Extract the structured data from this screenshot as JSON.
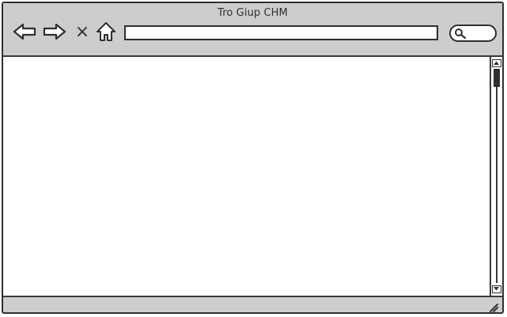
{
  "window": {
    "title": "Tro Giup CHM"
  },
  "toolbar": {
    "buttons": [
      {
        "label": "back",
        "icon": "arrow-left-icon"
      },
      {
        "label": "forward",
        "icon": "arrow-right-icon"
      },
      {
        "label": "stop",
        "icon": "close-icon"
      },
      {
        "label": "home",
        "icon": "home-icon"
      }
    ],
    "stop_symbol": "×"
  },
  "address_bar": {
    "value": ""
  },
  "search": {
    "icon": "search-icon"
  },
  "colors": {
    "chrome": "#cdcdcd",
    "border": "#2f2f2f",
    "content": "#ffffff"
  }
}
